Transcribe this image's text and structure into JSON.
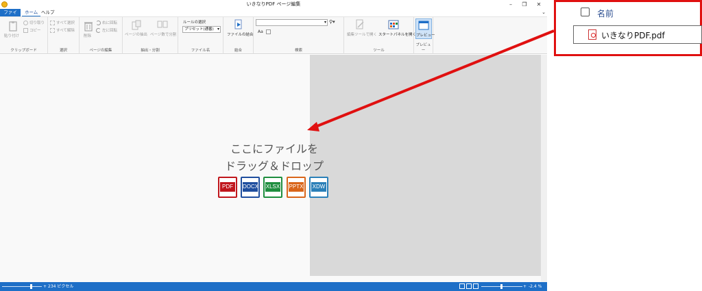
{
  "window": {
    "title": "いきなりPDF ページ編集",
    "controls": [
      "–",
      "❐",
      "✕"
    ]
  },
  "menu": {
    "file": "ファイル",
    "home": "ホーム",
    "help": "ヘルプ",
    "collapse": "⌄"
  },
  "ribbon": {
    "clipboard": {
      "label": "クリップボード",
      "paste": "貼り付け",
      "cut": "切り取り",
      "copy": "コピー"
    },
    "select": {
      "label": "選択",
      "select_all": "すべて選択",
      "deselect_all": "すべて解除"
    },
    "page_edit": {
      "label": "ページの編集",
      "delete": "削除",
      "rotate_right": "右に回転",
      "rotate_left": "左に回転"
    },
    "extract": {
      "label": "抽出・分割",
      "extract_pages": "ページの抽出",
      "split_by_count": "ページ数で分割"
    },
    "filename": {
      "label": "ファイル名",
      "rule_select": "ルールの選択",
      "preset_value": "プリセット(通番)"
    },
    "merge": {
      "label": "結合",
      "merge_files": "ファイルの結合"
    },
    "search": {
      "label": "検索",
      "search_value": "",
      "match_case": "Aa"
    },
    "tools": {
      "label": "ツール",
      "open_edit_tool": "編集ツールで開く",
      "open_start_panel": "スタートパネルを開く"
    },
    "preview": {
      "label": "プレビュー",
      "preview_button": "プレビュー"
    }
  },
  "dropzone": {
    "line1": "ここにファイルを",
    "line2": "ドラッグ＆ドロップ",
    "file_types": [
      {
        "label": "PDF",
        "color": "#c0161c"
      },
      {
        "label": "DOCX",
        "color": "#1f4e9e"
      },
      {
        "label": "XLSX",
        "color": "#1e8e3e"
      },
      {
        "label": "PPTX",
        "color": "#d9651a"
      },
      {
        "label": "XDW",
        "color": "#2a7fb8"
      }
    ]
  },
  "statusbar": {
    "thumb_size": "234 ピクセル",
    "zoom": "-2.4 %"
  },
  "explorer": {
    "column_name": "名前",
    "file_name": "いきなりPDF.pdf"
  },
  "colors": {
    "accent": "#1e6fc7",
    "highlight": "#e01010"
  }
}
